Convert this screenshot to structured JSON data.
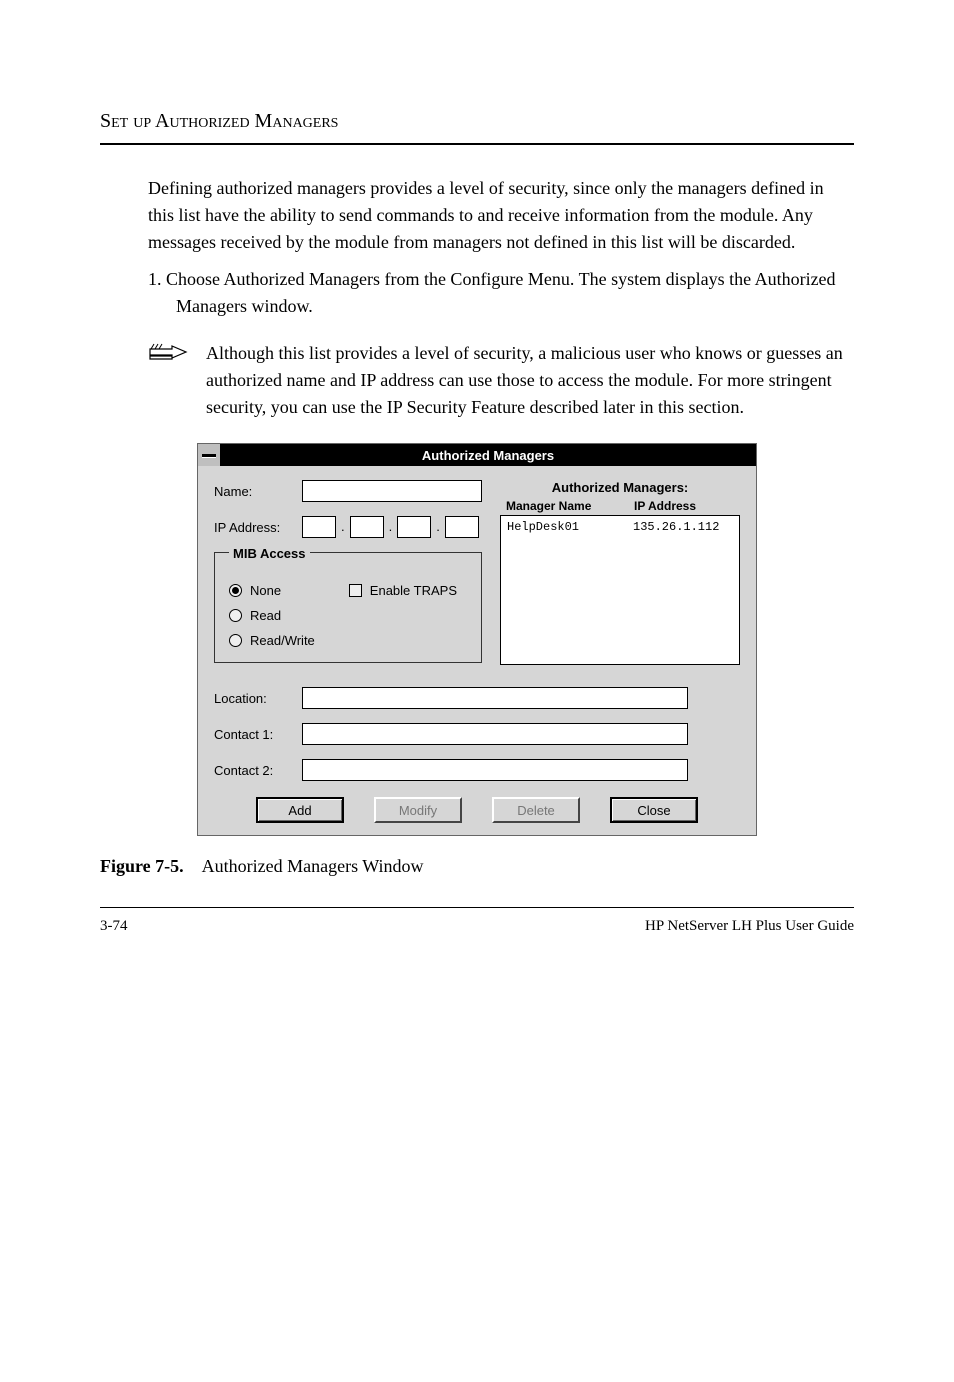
{
  "section_heading": "Set up Authorized Managers",
  "paragraphs": {
    "intro": "Defining authorized managers provides a level of security, since only the managers defined in this list have the ability to send commands to and receive information from the module. Any messages received by the module from managers not defined in this list will be discarded.",
    "step1": "1. Choose Authorized Managers from the Configure Menu. The system displays the Authorized Managers window."
  },
  "note_text": "Although this list provides a level of security, a malicious user who knows or guesses an authorized name and IP address can use those to access the module. For more stringent security, you can use the IP Security Feature described later in this section.",
  "dialog": {
    "title": "Authorized Managers",
    "labels": {
      "name": "Name:",
      "ip": "IP Address:",
      "mib_access": "MIB Access",
      "none": "None",
      "read": "Read",
      "readwrite": "Read/Write",
      "enable_traps": "Enable TRAPS",
      "auth_mgrs": "Authorized Managers:",
      "col_name": "Manager Name",
      "col_ip": "IP Address",
      "location": "Location:",
      "contact1": "Contact 1:",
      "contact2": "Contact 2:"
    },
    "buttons": {
      "add": "Add",
      "modify": "Modify",
      "delete": "Delete",
      "close": "Close"
    },
    "list": [
      {
        "name": "HelpDesk01",
        "ip": "135.26.1.112"
      }
    ],
    "mib_selected": "none",
    "traps_checked": false,
    "name_value": "",
    "ip_value": [
      "",
      "",
      "",
      ""
    ],
    "location_value": "",
    "contact1_value": "",
    "contact2_value": ""
  },
  "figure": {
    "label": "Figure 7-5.",
    "caption": "Authorized Managers Window"
  },
  "footer": {
    "left": "3-74",
    "right": "HP NetServer LH Plus User Guide"
  }
}
